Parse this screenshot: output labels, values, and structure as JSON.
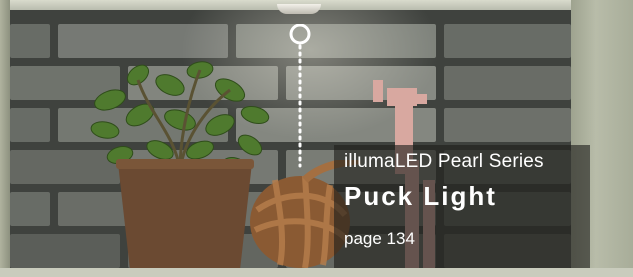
{
  "callout": {
    "series": "illumaLED Pearl Series",
    "product": "Puck Light",
    "page": "page 134"
  },
  "colors": {
    "callout_background": "#1e1e1c",
    "callout_text": "#ffffff",
    "leader_line": "#ffffff",
    "pot": "#6b4a32",
    "rope": "#8a5a33",
    "figure": "#d8a8a0"
  },
  "icons": {
    "hotspot": "ring-marker-icon",
    "light": "puck-light-icon"
  }
}
